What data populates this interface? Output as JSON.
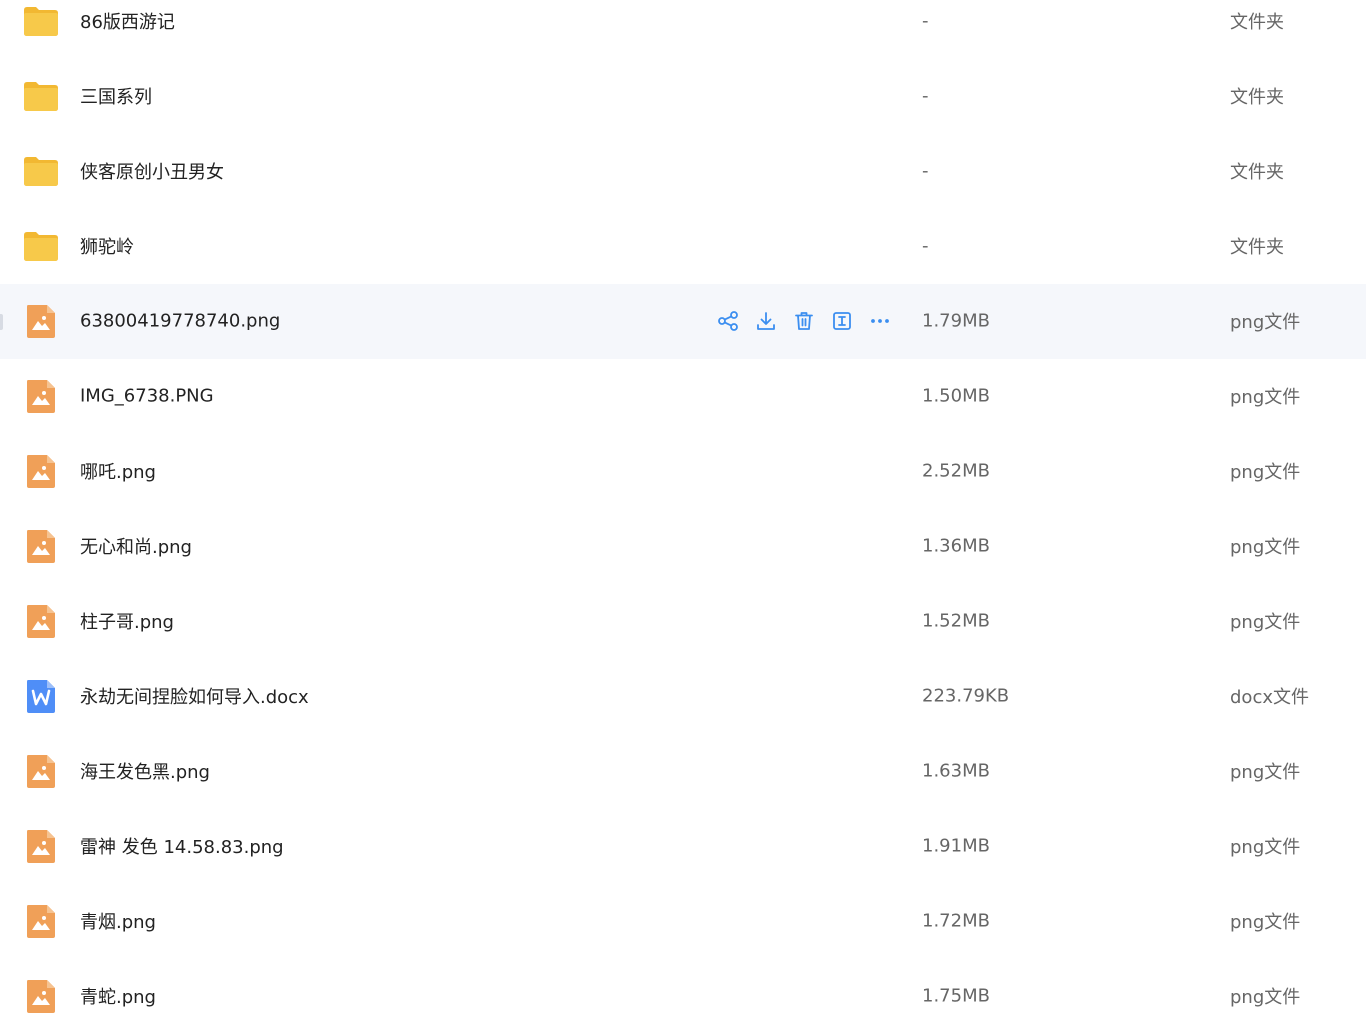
{
  "files": [
    {
      "name": "86版西游记",
      "size": "-",
      "type": "文件夹",
      "icon": "folder-icon"
    },
    {
      "name": "三国系列",
      "size": "-",
      "type": "文件夹",
      "icon": "folder-icon"
    },
    {
      "name": "侠客原创小丑男女",
      "size": "-",
      "type": "文件夹",
      "icon": "folder-icon"
    },
    {
      "name": "狮驼岭",
      "size": "-",
      "type": "文件夹",
      "icon": "folder-icon"
    },
    {
      "name": "63800419778740.png",
      "size": "1.79MB",
      "type": "png文件",
      "icon": "image-file-icon",
      "hovered": true
    },
    {
      "name": "IMG_6738.PNG",
      "size": "1.50MB",
      "type": "png文件",
      "icon": "image-file-icon"
    },
    {
      "name": "哪吒.png",
      "size": "2.52MB",
      "type": "png文件",
      "icon": "image-file-icon"
    },
    {
      "name": "无心和尚.png",
      "size": "1.36MB",
      "type": "png文件",
      "icon": "image-file-icon"
    },
    {
      "name": "柱子哥.png",
      "size": "1.52MB",
      "type": "png文件",
      "icon": "image-file-icon"
    },
    {
      "name": "永劫无间捏脸如何导入.docx",
      "size": "223.79KB",
      "type": "docx文件",
      "icon": "word-file-icon"
    },
    {
      "name": "海王发色黑.png",
      "size": "1.63MB",
      "type": "png文件",
      "icon": "image-file-icon"
    },
    {
      "name": "雷神 发色 14.58.83.png",
      "size": "1.91MB",
      "type": "png文件",
      "icon": "image-file-icon"
    },
    {
      "name": "青烟.png",
      "size": "1.72MB",
      "type": "png文件",
      "icon": "image-file-icon"
    },
    {
      "name": "青蛇.png",
      "size": "1.75MB",
      "type": "png文件",
      "icon": "image-file-icon"
    }
  ],
  "row_actions": [
    {
      "name": "share-icon"
    },
    {
      "name": "download-icon"
    },
    {
      "name": "delete-icon"
    },
    {
      "name": "rename-icon"
    },
    {
      "name": "more-icon"
    }
  ],
  "colors": {
    "folder": "#f7c94a",
    "image_file": "#f0a058",
    "word_file": "#4f8ef7",
    "action_icon": "#3b8ef0",
    "hover_row": "#f5f7fb"
  }
}
